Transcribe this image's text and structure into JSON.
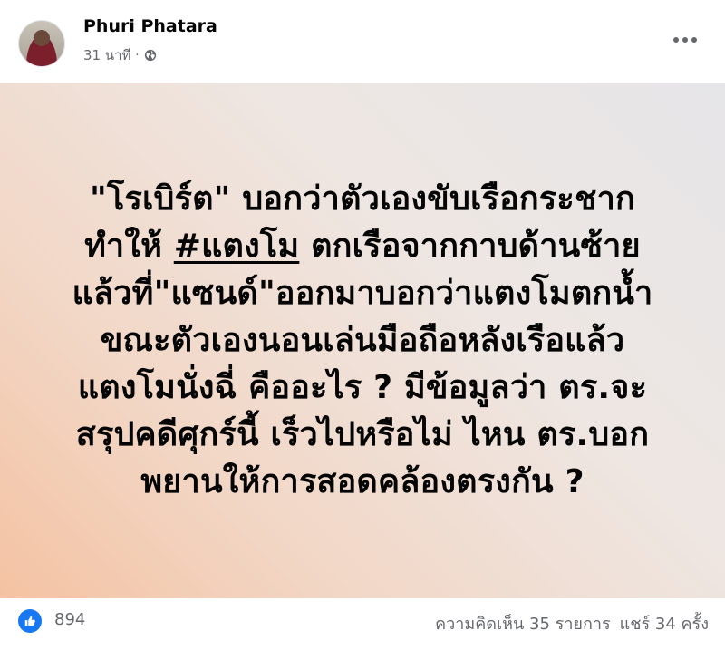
{
  "post": {
    "author": "Phuri Phatara",
    "time": "31 นาที",
    "separator": "·",
    "audience_icon": "globe-icon",
    "more_icon": "more-horizontal-icon",
    "lines": [
      {
        "before": "\"โรเบิร์ต\" บอกว่าตัวเองขับเรือกระชาก",
        "hashtag": "",
        "after": ""
      },
      {
        "before": "ทำให้ ",
        "hashtag": "#แตงโม",
        "after": " ตกเรือจากกาบด้านซ้าย"
      },
      {
        "before": "แล้วที่\"แซนด์\"ออกมาบอกว่าแตงโมตกน้ำ",
        "hashtag": "",
        "after": ""
      },
      {
        "before": "ขณะตัวเองนอนเล่นมือถือหลังเรือแล้ว",
        "hashtag": "",
        "after": ""
      },
      {
        "before": "แตงโมนั่งฉี่ คืออะไร ? มีข้อมูลว่า ตร.จะ",
        "hashtag": "",
        "after": ""
      },
      {
        "before": "สรุปคดีศุกร์นี้ เร็วไปหรือไม่ ไหน ตร.บอก",
        "hashtag": "",
        "after": ""
      },
      {
        "before": "พยานให้การสอดคล้องตรงกัน ?",
        "hashtag": "",
        "after": ""
      }
    ]
  },
  "reactions": {
    "like_icon": "thumbs-up-icon",
    "count": "894",
    "comments": "ความคิดเห็น 35 รายการ",
    "shares": "แชร์ 34 ครั้ง"
  },
  "colors": {
    "accent": "#1877f2",
    "secondary_text": "#65676b",
    "gradient_start": "#e6e5e8",
    "gradient_end": "#f4c2a2"
  }
}
